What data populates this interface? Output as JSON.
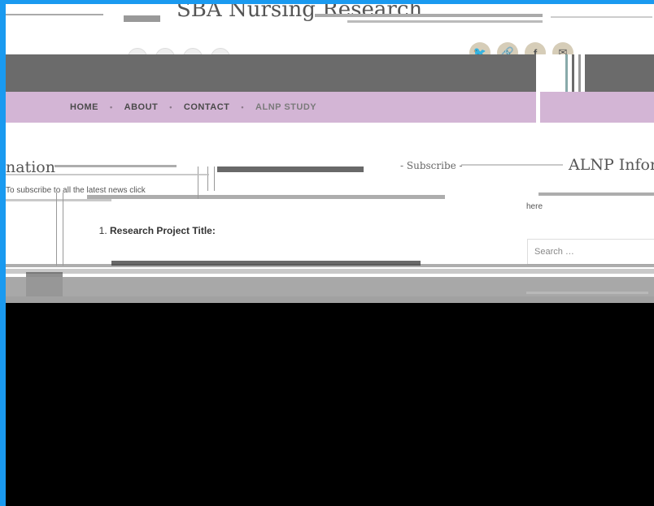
{
  "site": {
    "title": "SBA Nursing Research",
    "tagline": "",
    "social": [
      {
        "icon": "twitter-icon",
        "glyph": "🐦"
      },
      {
        "icon": "link-icon",
        "glyph": "🔗"
      },
      {
        "icon": "facebook-icon",
        "glyph": "f"
      },
      {
        "icon": "email-icon",
        "glyph": "✉"
      }
    ]
  },
  "nav": {
    "items": [
      {
        "label": "HOME"
      },
      {
        "label": "ABOUT"
      },
      {
        "label": "CONTACT"
      },
      {
        "label": "ALNP STUDY"
      }
    ]
  },
  "content": {
    "section_title": "nation",
    "subscribe_heading": "- Subscribe -",
    "right_heading": "ALNP Infor",
    "subscribe_text": "To subscribe to all the latest news click",
    "side_text": "here",
    "list": [
      {
        "label": "Research Project Title:"
      }
    ]
  },
  "search": {
    "placeholder": "Search …"
  },
  "colors": {
    "frame": "#1a9af0",
    "nav_bg": "#d3b5d5",
    "banner_bg": "#6b6b6b"
  }
}
